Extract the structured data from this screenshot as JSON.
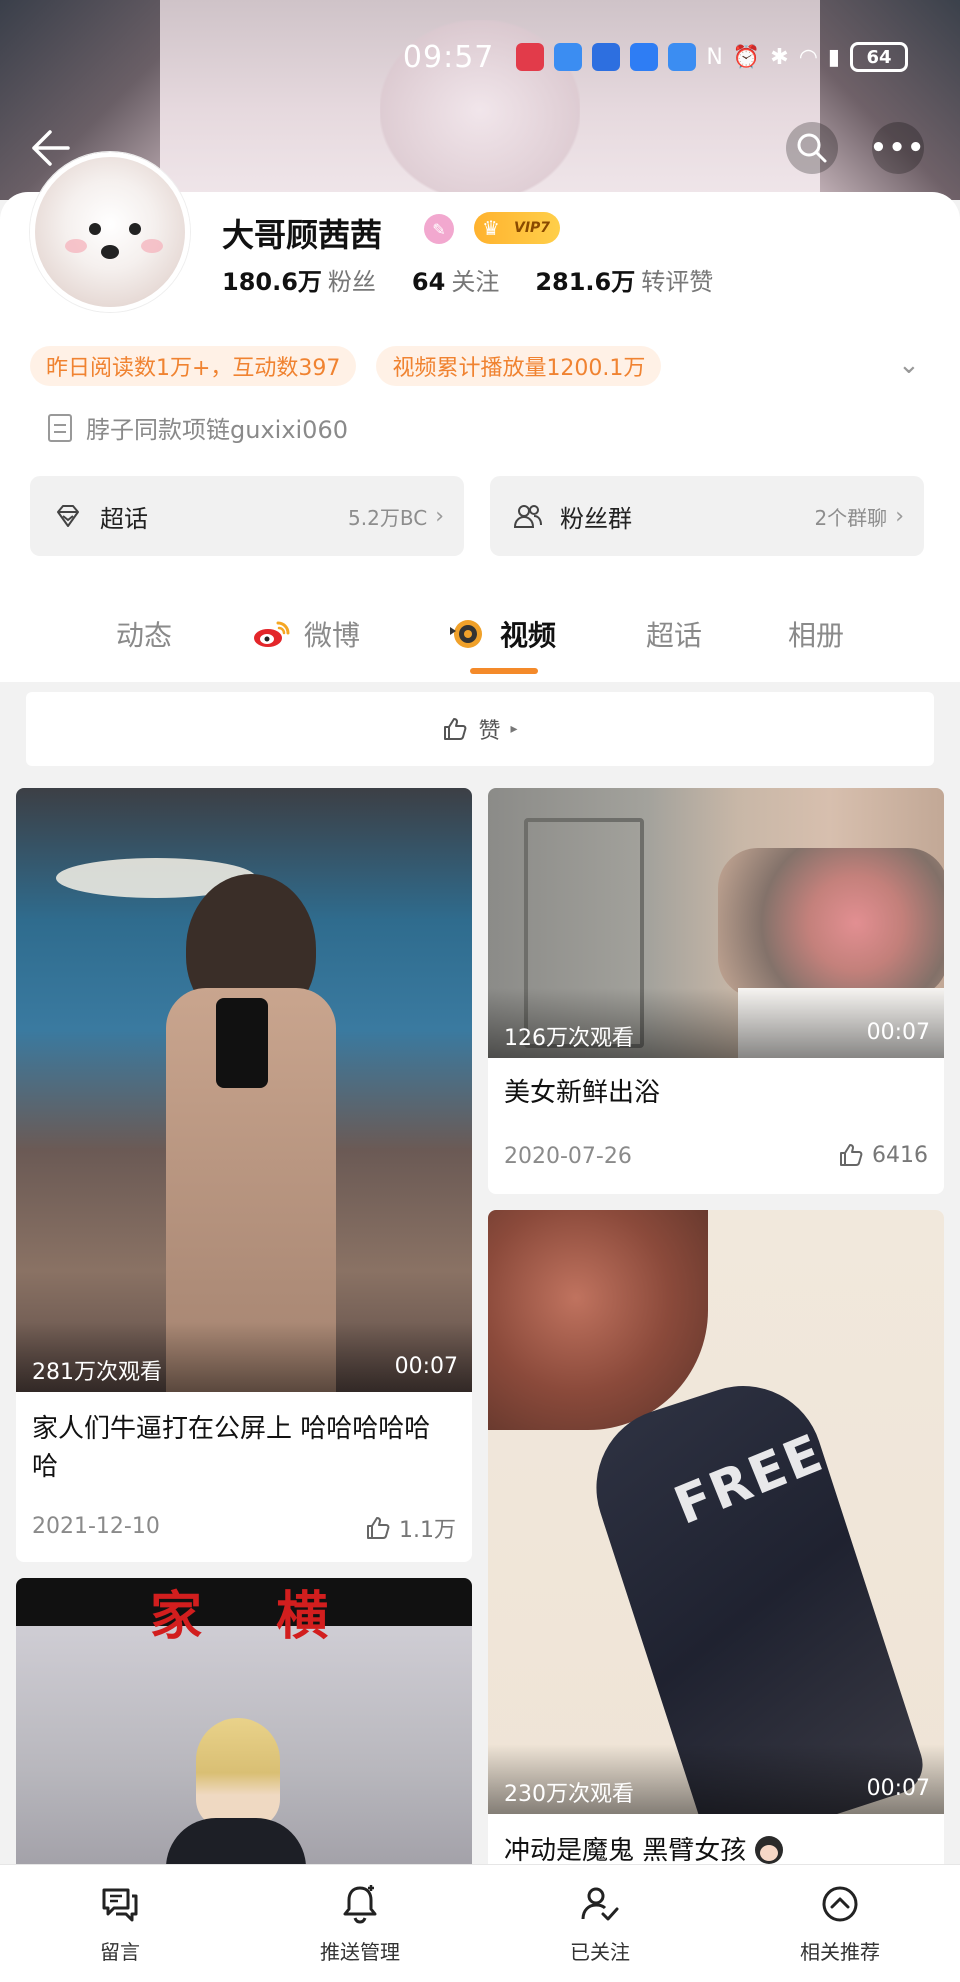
{
  "status_bar": {
    "time": "09:57",
    "battery": "64"
  },
  "profile": {
    "name": "大哥顾茜茜",
    "vip_label": "VIP7",
    "stats": [
      {
        "value": "180.6万",
        "label": "粉丝"
      },
      {
        "value": "64",
        "label": "关注"
      },
      {
        "value": "281.6万",
        "label": "转评赞"
      }
    ],
    "tags": [
      "昨日阅读数1万+，互动数397",
      "视频累计播放量1200.1万"
    ],
    "bio": "脖子同款项链guxixi060",
    "tiles": [
      {
        "name": "超话",
        "meta": "5.2万BC"
      },
      {
        "name": "粉丝群",
        "meta": "2个群聊"
      }
    ]
  },
  "tabs": [
    {
      "label": "动态",
      "active": false
    },
    {
      "label": "微博",
      "active": false
    },
    {
      "label": "视频",
      "active": true
    },
    {
      "label": "超话",
      "active": false
    },
    {
      "label": "相册",
      "active": false
    }
  ],
  "like_filter": {
    "label": "赞"
  },
  "videos": [
    {
      "views": "281万次观看",
      "duration": "00:07",
      "title": "家人们牛逼打在公屏上 哈哈哈哈哈哈",
      "date": "2021-12-10",
      "likes": "1.1万"
    },
    {
      "views": "126万次观看",
      "duration": "00:07",
      "title": "美女新鲜出浴",
      "date": "2020-07-26",
      "likes": "6416"
    },
    {
      "views": "230万次观看",
      "duration": "00:07",
      "title": "冲动是魔鬼 黑臂女孩",
      "thumb_text": "FREE"
    },
    {
      "thumb_text": "家 横"
    }
  ],
  "bottom_bar": [
    {
      "label": "留言",
      "icon": "message-icon"
    },
    {
      "label": "推送管理",
      "icon": "bell-icon"
    },
    {
      "label": "已关注",
      "icon": "user-check-icon"
    },
    {
      "label": "相关推荐",
      "icon": "chevron-up-circle-icon"
    }
  ],
  "colors": {
    "accent": "#f48a2a",
    "tag_bg": "#fff1e6",
    "tag_text": "#f08331"
  }
}
